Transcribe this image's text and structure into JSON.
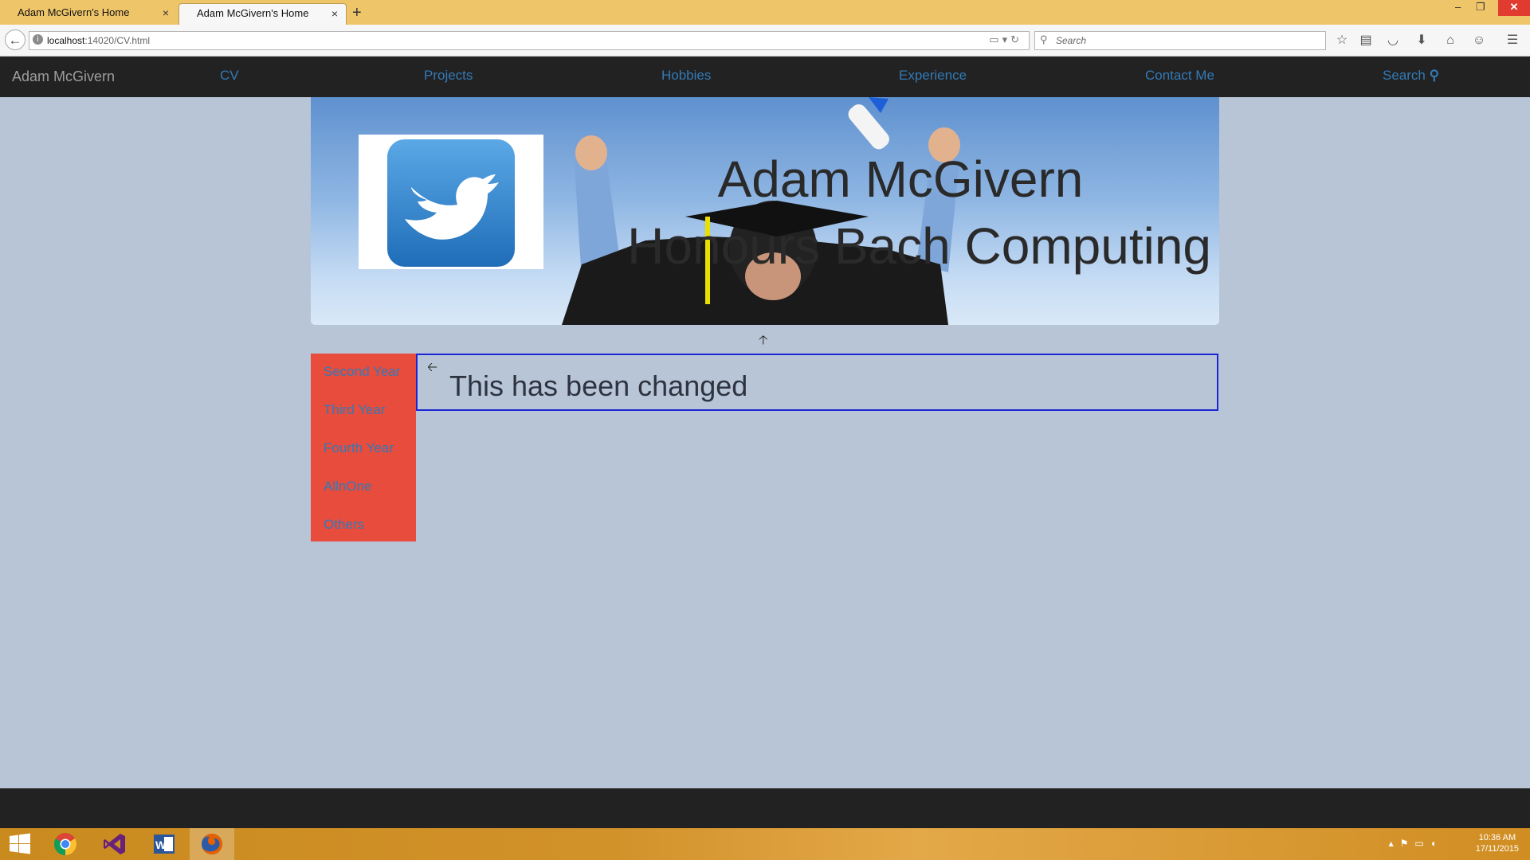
{
  "browser": {
    "tabs": [
      {
        "label": "Adam McGivern's Home",
        "active": false
      },
      {
        "label": "Adam McGivern's Home",
        "active": true
      }
    ],
    "url_host": "localhost",
    "url_rest": ":14020/CV.html",
    "search_placeholder": "Search",
    "close_glyph": "×",
    "new_tab_glyph": "+",
    "window_buttons": [
      "–",
      "❐",
      "✕"
    ],
    "toolbar_icons": [
      "star-icon",
      "reading-list-icon",
      "pocket-icon",
      "download-icon",
      "home-icon",
      "chat-icon",
      "menu-icon"
    ]
  },
  "site": {
    "brand": "Adam McGivern",
    "nav": [
      "CV",
      "Projects",
      "Hobbies",
      "Experience",
      "Contact Me",
      "Search"
    ],
    "header": {
      "name": "Adam McGivern",
      "degree": "Honours Bach Computing"
    },
    "sidebar": [
      "Second Year",
      "Third Year",
      "Fourth Year",
      "AllnOne",
      "Others"
    ],
    "main_text": "This has been changed"
  },
  "taskbar": {
    "apps": [
      "windows-start-icon",
      "chrome-icon",
      "visual-studio-icon",
      "word-icon",
      "firefox-icon"
    ],
    "time": "10:36 AM",
    "date": "17/11/2015"
  },
  "colors": {
    "page_bg": "#b8c5d6",
    "navbar_bg": "#222222",
    "link": "#337ab7",
    "sidebar_bg": "#e74c3c",
    "box_border": "#1c25d6"
  }
}
